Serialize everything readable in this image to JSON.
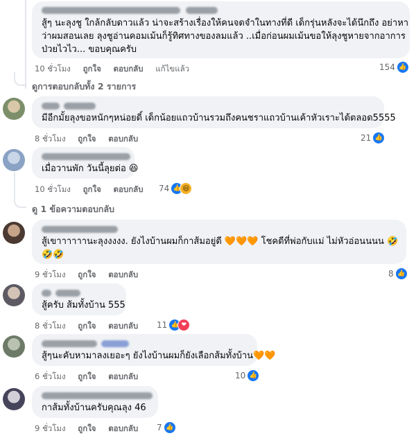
{
  "comments": [
    {
      "text_lines": [
        "สู้ๆ นะลุงชู ใกล้กลับดาวแล้ว น่าจะสร้างเรื่องให้คนจดจำในทางที่ดี เด็กรุ่นหลังจะได้นึกถึง อย่าหา",
        "ว่าผมสอนเลย ลุงชูอ่านคอมเม้นก็รู้ทิศทางของลมแล้ว ..เมื่อก่อนผมเม้นขอให้ลุงชูหายจากอาการ",
        "ป่วยไวไว... ขอบคุณครับ"
      ],
      "time": "10 ชั่วโมง",
      "like": "ถูกใจ",
      "reply": "ตอบกลับ",
      "edited": "แก้ไขแล้ว",
      "reaction_count": "154",
      "reactions": [
        "like"
      ]
    },
    {
      "text_lines": [
        "มีอีกมั้ยลุงขอหนักๆหน่อยดิ์ เด็กน้อยแถวบ้านรวมถึงคนชราแถวบ้านเค้าหัวเราะได้ตลอด5555"
      ],
      "time": "8 ชั่วโมง",
      "like": "ถูกใจ",
      "reply": "ตอบกลับ",
      "reaction_count": "21",
      "reactions": [
        "like"
      ]
    },
    {
      "text_lines": [
        "เมื่อวานพัก วันนี้ลุยต่อ 😆"
      ],
      "time": "10 ชั่วโมง",
      "like": "ถูกใจ",
      "reply": "ตอบกลับ",
      "reaction_count": "74",
      "reactions": [
        "like",
        "haha"
      ]
    },
    {
      "text_lines": [
        "สู้เขาาาาาานะลุงงงงง. ยังไงบ้านผมก็กาส้มอยู่ดี 🧡🧡🧡 โชคดีที่พ่อกับแม่ ไม่หัวอ่อนนนน 🤣",
        "🤣🤣"
      ],
      "time": "9 ชั่วโมง",
      "like": "ถูกใจ",
      "reply": "ตอบกลับ",
      "reaction_count": "8",
      "reactions": [
        "like"
      ]
    },
    {
      "text_lines": [
        "สู้ครับ ส้มทั้งบ้าน 555"
      ],
      "time": "8 ชั่วโมง",
      "like": "ถูกใจ",
      "reply": "ตอบกลับ",
      "reaction_count": "11",
      "reactions": [
        "like",
        "love"
      ]
    },
    {
      "text_lines": [
        "สู้ๆนะคับหามาลงเยอะๆ ยังไงบ้านผมก็ยังเลือกส้มทั้งบ้าน🧡🧡"
      ],
      "time": "6 ชั่วโมง",
      "like": "ถูกใจ",
      "reply": "ตอบกลับ",
      "reaction_count": "10",
      "reactions": [
        "like"
      ]
    },
    {
      "text_lines": [
        "กาส้มทั้งบ้านครับคุณลุง 46"
      ],
      "time": "9 ชั่วโมง",
      "like": "ถูกใจ",
      "reply": "ตอบกลับ",
      "reaction_count": "7",
      "reactions": [
        "like"
      ]
    }
  ],
  "view_replies_1": "ดูการตอบกลับทั้ง 2 รายการ",
  "view_replies_2": "ดู 1 ข้อความตอบกลับ",
  "colors": {
    "bubble": "#f0f2f5",
    "meta_text": "#65676b",
    "like_blue": "#1877f2",
    "love_red": "#f33e58",
    "haha_yellow": "#f7b125"
  }
}
